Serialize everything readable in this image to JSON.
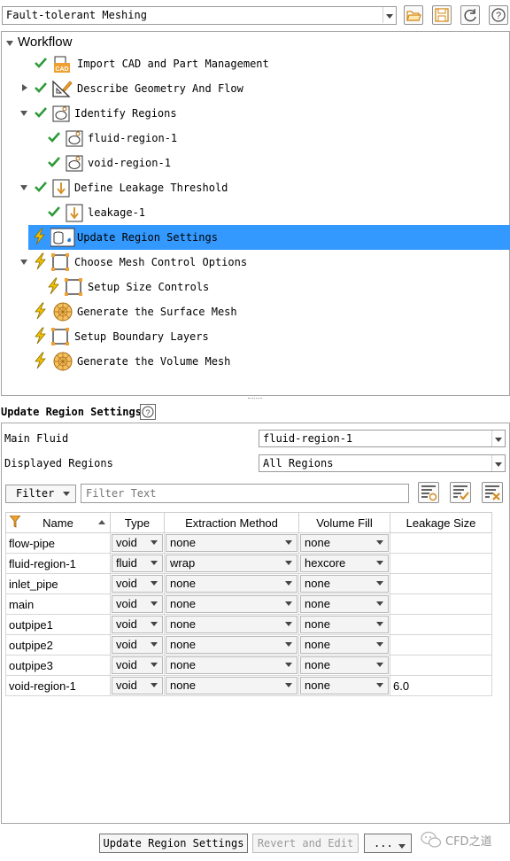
{
  "mode_selector": {
    "value": "Fault-tolerant Meshing"
  },
  "workflow": {
    "title": "Workflow",
    "items": [
      {
        "label": "Import CAD and Part Management"
      },
      {
        "label": "Describe Geometry And Flow"
      },
      {
        "label": "Identify Regions"
      },
      {
        "label": "fluid-region-1"
      },
      {
        "label": "void-region-1"
      },
      {
        "label": "Define Leakage Threshold"
      },
      {
        "label": "leakage-1"
      },
      {
        "label": "Update Region Settings"
      },
      {
        "label": "Choose Mesh Control Options"
      },
      {
        "label": "Setup Size Controls"
      },
      {
        "label": "Generate the Surface Mesh"
      },
      {
        "label": "Setup Boundary Layers"
      },
      {
        "label": "Generate the Volume Mesh"
      }
    ]
  },
  "panel": {
    "title": "Update Region Settings",
    "main_fluid_label": "Main Fluid",
    "main_fluid_value": "fluid-region-1",
    "displayed_regions_label": "Displayed Regions",
    "displayed_regions_value": "All Regions",
    "filter_button": "Filter",
    "filter_placeholder": "Filter Text"
  },
  "table": {
    "columns": [
      "Name",
      "Type",
      "Extraction Method",
      "Volume Fill",
      "Leakage Size"
    ],
    "rows": [
      {
        "name": "flow-pipe",
        "type": "void",
        "method": "none",
        "fill": "none",
        "leak": ""
      },
      {
        "name": "fluid-region-1",
        "type": "fluid",
        "method": "wrap",
        "fill": "hexcore",
        "leak": ""
      },
      {
        "name": "inlet_pipe",
        "type": "void",
        "method": "none",
        "fill": "none",
        "leak": ""
      },
      {
        "name": "main",
        "type": "void",
        "method": "none",
        "fill": "none",
        "leak": ""
      },
      {
        "name": "outpipe1",
        "type": "void",
        "method": "none",
        "fill": "none",
        "leak": ""
      },
      {
        "name": "outpipe2",
        "type": "void",
        "method": "none",
        "fill": "none",
        "leak": ""
      },
      {
        "name": "outpipe3",
        "type": "void",
        "method": "none",
        "fill": "none",
        "leak": ""
      },
      {
        "name": "void-region-1",
        "type": "void",
        "method": "none",
        "fill": "none",
        "leak": "6.0"
      }
    ]
  },
  "footer": {
    "update_button": "Update Region Settings",
    "revert_button": "Revert and Edit",
    "more_button": "...",
    "watermark": "CFD之道"
  },
  "colors": {
    "selection": "#3399ff",
    "check": "#2e9a3a",
    "bolt": "#f2c200",
    "cad_orange": "#f0a030"
  }
}
